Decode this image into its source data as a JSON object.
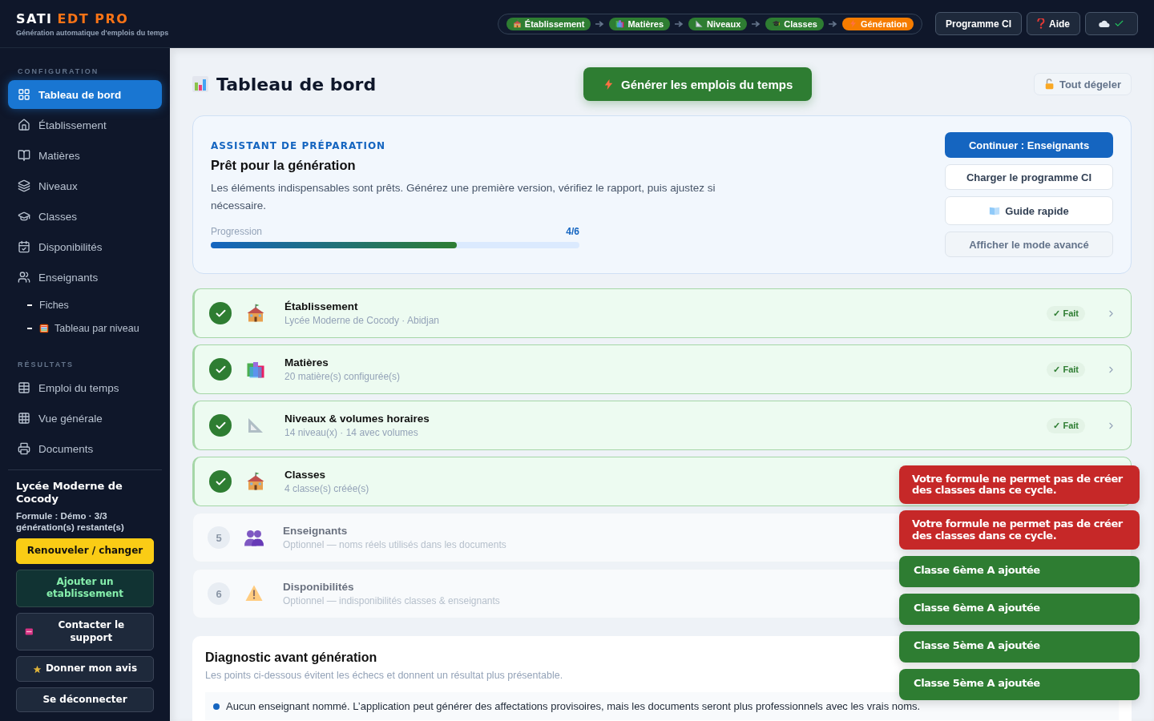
{
  "brand": {
    "name_part_1": "SATI",
    "name_part_2": "EDT PRO",
    "tagline": "Génération automatique d'emplois du temps"
  },
  "stepper": [
    {
      "label": "Établissement",
      "selected": false
    },
    {
      "label": "Matières",
      "selected": false
    },
    {
      "label": "Niveaux",
      "selected": false
    },
    {
      "label": "Classes",
      "selected": false
    },
    {
      "label": "Génération",
      "selected": true
    }
  ],
  "header_buttons": [
    {
      "label": "Programme CI",
      "kind": "text"
    },
    {
      "label": "Aide",
      "kind": "help"
    },
    {
      "kind": "sync"
    }
  ],
  "sidebar": {
    "sections": [
      {
        "title": "CONFIGURATION",
        "items": [
          {
            "label": "Tableau de bord",
            "selected": true
          },
          {
            "label": "Établissement",
            "selected": false
          },
          {
            "label": "Matières",
            "selected": false
          },
          {
            "label": "Niveaux",
            "selected": false
          },
          {
            "label": "Classes",
            "selected": false
          },
          {
            "label": "Disponibilités",
            "selected": false
          },
          {
            "label": "Enseignants",
            "selected": false,
            "children": [
              {
                "label": "Fiches",
                "selected": false
              },
              {
                "label": "Tableau par niveau",
                "selected": false
              }
            ]
          }
        ]
      },
      {
        "title": "RÉSULTATS",
        "items": [
          {
            "label": "Emploi du temps",
            "selected": false
          },
          {
            "label": "Vue générale",
            "selected": false
          },
          {
            "label": "Documents",
            "selected": false
          }
        ]
      }
    ],
    "school": "Lycée Moderne de Cocody",
    "plan": "Formule : Démo · 3/3 génération(s) restante(s)",
    "buttons": [
      {
        "label": "Renouveler / changer",
        "kind": "warning"
      },
      {
        "label": "Ajouter un etablissement",
        "kind": "success"
      },
      {
        "label": "Contacter le support",
        "kind": "sos"
      },
      {
        "label": "Donner mon avis",
        "kind": "star"
      },
      {
        "label": "Se déconnecter",
        "kind": "plain"
      }
    ]
  },
  "page": {
    "title": "Tableau de bord",
    "generate_button": "Générer les emplois du temps",
    "unfreeze_button": "Tout dégeler"
  },
  "assistant": {
    "eyebrow": "ASSISTANT DE PRÉPARATION",
    "title": "Prêt pour la génération",
    "text": "Les éléments indispensables sont prêts. Générez une première version, vérifiez le rapport, puis ajustez si nécessaire.",
    "progress_label": "Progression",
    "progress_value": "4/6",
    "level": 0.667,
    "actions": [
      {
        "label": "Continuer : Enseignants",
        "kind": "primary"
      },
      {
        "label": "Charger le programme CI",
        "kind": "outline"
      },
      {
        "label": "Guide rapide",
        "kind": "guide"
      },
      {
        "label": "Afficher le mode avancé",
        "kind": "muted"
      }
    ]
  },
  "steps": [
    {
      "title": "Établissement",
      "subtitle": "Lycée Moderne de Cocody · Abidjan",
      "done": true,
      "badge": "✓ Fait"
    },
    {
      "title": "Matières",
      "subtitle": "20 matière(s) configurée(s)",
      "done": true,
      "badge": "✓ Fait"
    },
    {
      "title": "Niveaux & volumes horaires",
      "subtitle": "14 niveau(x) · 14 avec volumes",
      "done": true,
      "badge": "✓ Fait"
    },
    {
      "title": "Classes",
      "subtitle": "4 classe(s) créée(s)",
      "done": true
    },
    {
      "number": "5",
      "title": "Enseignants",
      "subtitle": "Optionnel — noms réels utilisés dans les documents",
      "done": false
    },
    {
      "number": "6",
      "title": "Disponibilités",
      "subtitle": "Optionnel — indisponibilités classes & enseignants",
      "done": false
    }
  ],
  "diagnostic": {
    "title": "Diagnostic avant génération",
    "subtitle": "Les points ci-dessous évitent les échecs et donnent un résultat plus présentable.",
    "items": [
      {
        "text": "Aucun enseignant nommé. L’application peut générer des affectations provisoires, mais les documents seront plus professionnels avec les vrais noms.",
        "color": "#1565c0"
      }
    ]
  },
  "toasts": [
    {
      "text": "Votre formule ne permet pas de créer des classes dans ce cycle.",
      "kind": "error"
    },
    {
      "text": "Votre formule ne permet pas de créer des classes dans ce cycle.",
      "kind": "error"
    },
    {
      "text": "Classe 6ème A ajoutée",
      "kind": "success"
    },
    {
      "text": "Classe 6ème A ajoutée",
      "kind": "success"
    },
    {
      "text": "Classe 5ème A ajoutée",
      "kind": "success"
    },
    {
      "text": "Classe 5ème A ajoutée",
      "kind": "success"
    }
  ]
}
